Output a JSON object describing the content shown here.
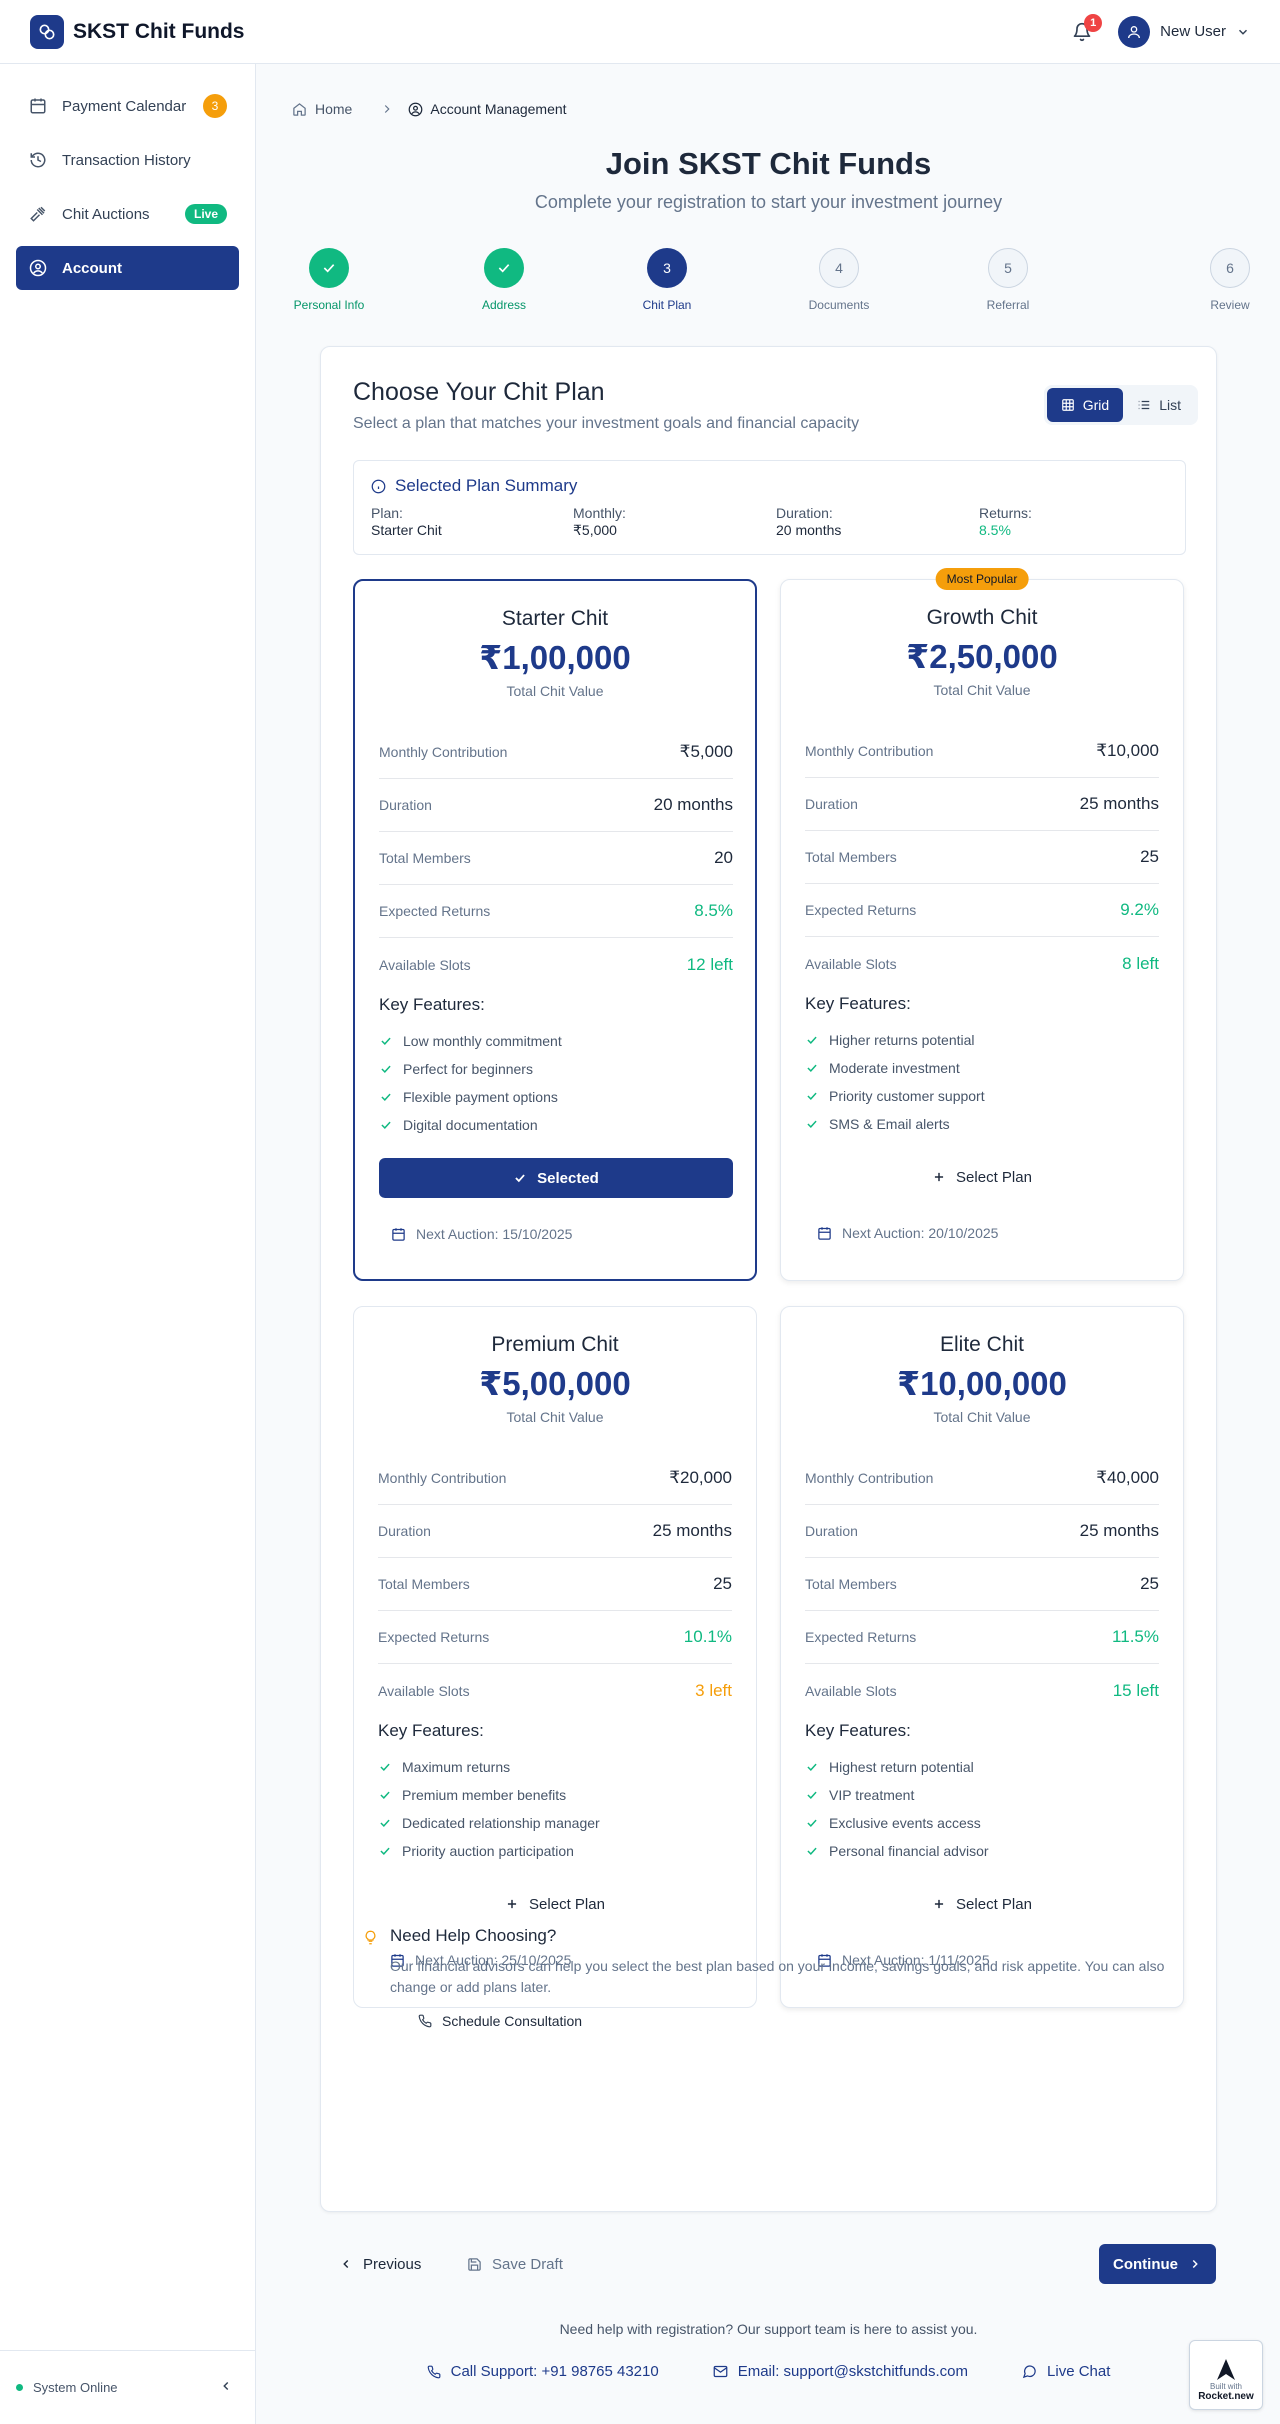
{
  "header": {
    "brand": "SKST Chit Funds",
    "notification_count": "1",
    "user_name": "New User"
  },
  "sidebar": {
    "items": [
      {
        "label": "Payment Calendar",
        "badge": "3",
        "icon": "calendar-icon"
      },
      {
        "label": "Transaction History",
        "icon": "history-icon"
      },
      {
        "label": "Chit Auctions",
        "badge": "Live",
        "icon": "gavel-icon"
      },
      {
        "label": "Account",
        "icon": "user-circle-icon",
        "active": true
      }
    ],
    "footer_status": "System Online"
  },
  "breadcrumb": {
    "home": "Home",
    "current": "Account Management"
  },
  "page": {
    "title": "Join SKST Chit Funds",
    "subtitle": "Complete your registration to start your investment journey"
  },
  "stepper": [
    {
      "num": "1",
      "label": "Personal Info",
      "state": "done"
    },
    {
      "num": "2",
      "label": "Address",
      "state": "done"
    },
    {
      "num": "3",
      "label": "Chit Plan",
      "state": "current"
    },
    {
      "num": "4",
      "label": "Documents",
      "state": "todo"
    },
    {
      "num": "5",
      "label": "Referral",
      "state": "todo"
    },
    {
      "num": "6",
      "label": "Review",
      "state": "todo"
    }
  ],
  "plans_section": {
    "title": "Choose Your Chit Plan",
    "subtitle": "Select a plan that matches your investment goals and financial capacity",
    "view_grid": "Grid",
    "view_list": "List"
  },
  "summary": {
    "title": "Selected Plan Summary",
    "plan_label": "Plan:",
    "plan_value": "Starter Chit",
    "monthly_label": "Monthly:",
    "monthly_value": "₹5,000",
    "duration_label": "Duration:",
    "duration_value": "20 months",
    "returns_label": "Returns:",
    "returns_value": "8.5%"
  },
  "labels": {
    "total_chit_value": "Total Chit Value",
    "monthly_contribution": "Monthly Contribution",
    "duration": "Duration",
    "total_members": "Total Members",
    "expected_returns": "Expected Returns",
    "available_slots": "Available Slots",
    "key_features": "Key Features:",
    "selected": "Selected",
    "select_plan": "Select Plan",
    "most_popular": "Most Popular"
  },
  "plans": [
    {
      "name": "Starter Chit",
      "value": "₹1,00,000",
      "monthly": "₹5,000",
      "duration": "20 months",
      "members": "20",
      "returns": "8.5%",
      "slots": "12 left",
      "slots_color": "green",
      "features": [
        "Low monthly commitment",
        "Perfect for beginners",
        "Flexible payment options",
        "Digital documentation"
      ],
      "next_auction": "Next Auction: 15/10/2025",
      "selected": true
    },
    {
      "name": "Growth Chit",
      "value": "₹2,50,000",
      "monthly": "₹10,000",
      "duration": "25 months",
      "members": "25",
      "returns": "9.2%",
      "slots": "8 left",
      "slots_color": "green",
      "features": [
        "Higher returns potential",
        "Moderate investment",
        "Priority customer support",
        "SMS & Email alerts"
      ],
      "next_auction": "Next Auction: 20/10/2025",
      "popular": true
    },
    {
      "name": "Premium Chit",
      "value": "₹5,00,000",
      "monthly": "₹20,000",
      "duration": "25 months",
      "members": "25",
      "returns": "10.1%",
      "slots": "3 left",
      "slots_color": "orange",
      "features": [
        "Maximum returns",
        "Premium member benefits",
        "Dedicated relationship manager",
        "Priority auction participation"
      ],
      "next_auction": "Next Auction: 25/10/2025"
    },
    {
      "name": "Elite Chit",
      "value": "₹10,00,000",
      "monthly": "₹40,000",
      "duration": "25 months",
      "members": "25",
      "returns": "11.5%",
      "slots": "15 left",
      "slots_color": "green",
      "features": [
        "Highest return potential",
        "VIP treatment",
        "Exclusive events access",
        "Personal financial advisor"
      ],
      "next_auction": "Next Auction: 1/11/2025"
    }
  ],
  "help": {
    "title": "Need Help Choosing?",
    "text": "Our financial advisors can help you select the best plan based on your income, savings goals, and risk appetite. You can also change or add plans later.",
    "button": "Schedule Consultation"
  },
  "footer_nav": {
    "previous": "Previous",
    "save_draft": "Save Draft",
    "continue": "Continue"
  },
  "support": {
    "text": "Need help with registration? Our support team is here to assist you.",
    "call": "Call Support: +91 98765 43210",
    "email": "Email: support@skstchitfunds.com",
    "chat": "Live Chat"
  },
  "badge": {
    "line1": "Built with",
    "line2": "Rocket.new"
  },
  "colors": {
    "primary": "#1e3a8a",
    "success": "#10b981",
    "warning": "#f59e0b",
    "danger": "#ef4444"
  }
}
